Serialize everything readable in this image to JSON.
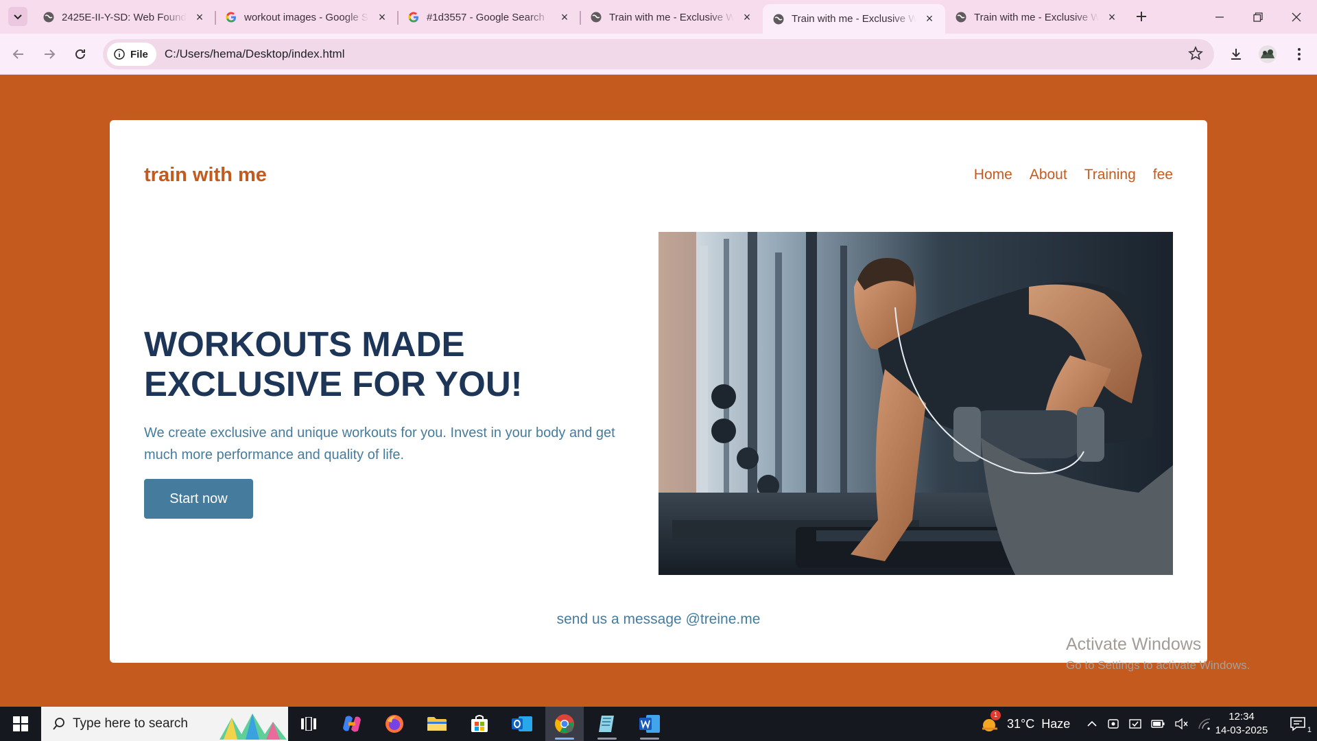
{
  "browser": {
    "tabs": [
      {
        "title": "2425E-II-Y-SD: Web Found",
        "favicon": "globe-icon"
      },
      {
        "title": "workout images - Google S",
        "favicon": "google-icon"
      },
      {
        "title": "#1d3557 - Google Search",
        "favicon": "google-icon"
      },
      {
        "title": "Train with me - Exclusive W",
        "favicon": "globe-icon"
      },
      {
        "title": "Train with me - Exclusive W",
        "favicon": "globe-icon",
        "active": true
      },
      {
        "title": "Train with me - Exclusive W",
        "favicon": "globe-icon"
      }
    ],
    "site_chip_label": "File",
    "url": "C:/Users/hema/Desktop/index.html"
  },
  "page": {
    "brand": "train with me",
    "nav": [
      "Home",
      "About",
      "Training",
      "fee"
    ],
    "hero_title_line1": "WORKOUTS MADE",
    "hero_title_line2": "EXCLUSIVE FOR YOU!",
    "hero_text": "We create exclusive and unique workouts for you. Invest in your body and get much more performance and quality of life.",
    "cta_label": "Start now",
    "contact": "send us a message @treine.me",
    "colors": {
      "background": "#c45a1e",
      "title": "#1d3557",
      "accent": "#457b9d",
      "card": "#ffffff"
    }
  },
  "watermark": {
    "line1": "Activate Windows",
    "line2": "Go to Settings to activate Windows."
  },
  "taskbar": {
    "search_placeholder": "Type here to search",
    "weather": "31°C  Haze",
    "weather_badge": "1",
    "time": "12:34",
    "date": "14-03-2025",
    "notification_count": "1"
  }
}
